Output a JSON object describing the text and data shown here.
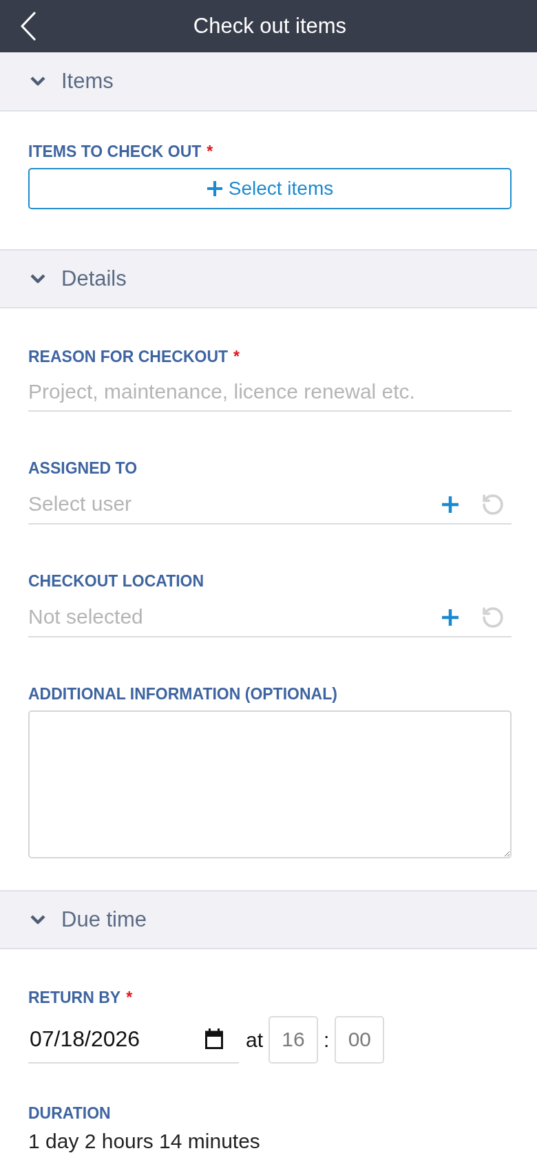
{
  "header": {
    "title": "Check out items"
  },
  "sections": [
    {
      "title": "Items",
      "expanded": true,
      "fields": [
        {
          "kind": "button",
          "label": "ITEMS TO CHECK OUT",
          "required_mark": "*",
          "button_label": "Select items"
        }
      ]
    },
    {
      "title": "Details",
      "expanded": true,
      "fields": [
        {
          "kind": "text",
          "label": "REASON FOR CHECKOUT",
          "required_mark": "*",
          "placeholder": "Project, maintenance, licence renewal etc."
        },
        {
          "kind": "picker",
          "label": "ASSIGNED TO",
          "placeholder": "Select user"
        },
        {
          "kind": "picker",
          "label": "CHECKOUT LOCATION",
          "placeholder": "Not selected"
        },
        {
          "kind": "textarea",
          "label": "ADDITIONAL INFORMATION (OPTIONAL)"
        }
      ]
    },
    {
      "title": "Due time",
      "expanded": true,
      "fields": [
        {
          "kind": "datetime",
          "label": "RETURN BY",
          "required_mark": "*",
          "date": "07/18/2026",
          "connector": "at",
          "hour": "16",
          "separator": ":",
          "minute": "00"
        },
        {
          "kind": "readout",
          "label": "DURATION",
          "value": "1 day 2 hours 14 minutes"
        }
      ]
    }
  ]
}
